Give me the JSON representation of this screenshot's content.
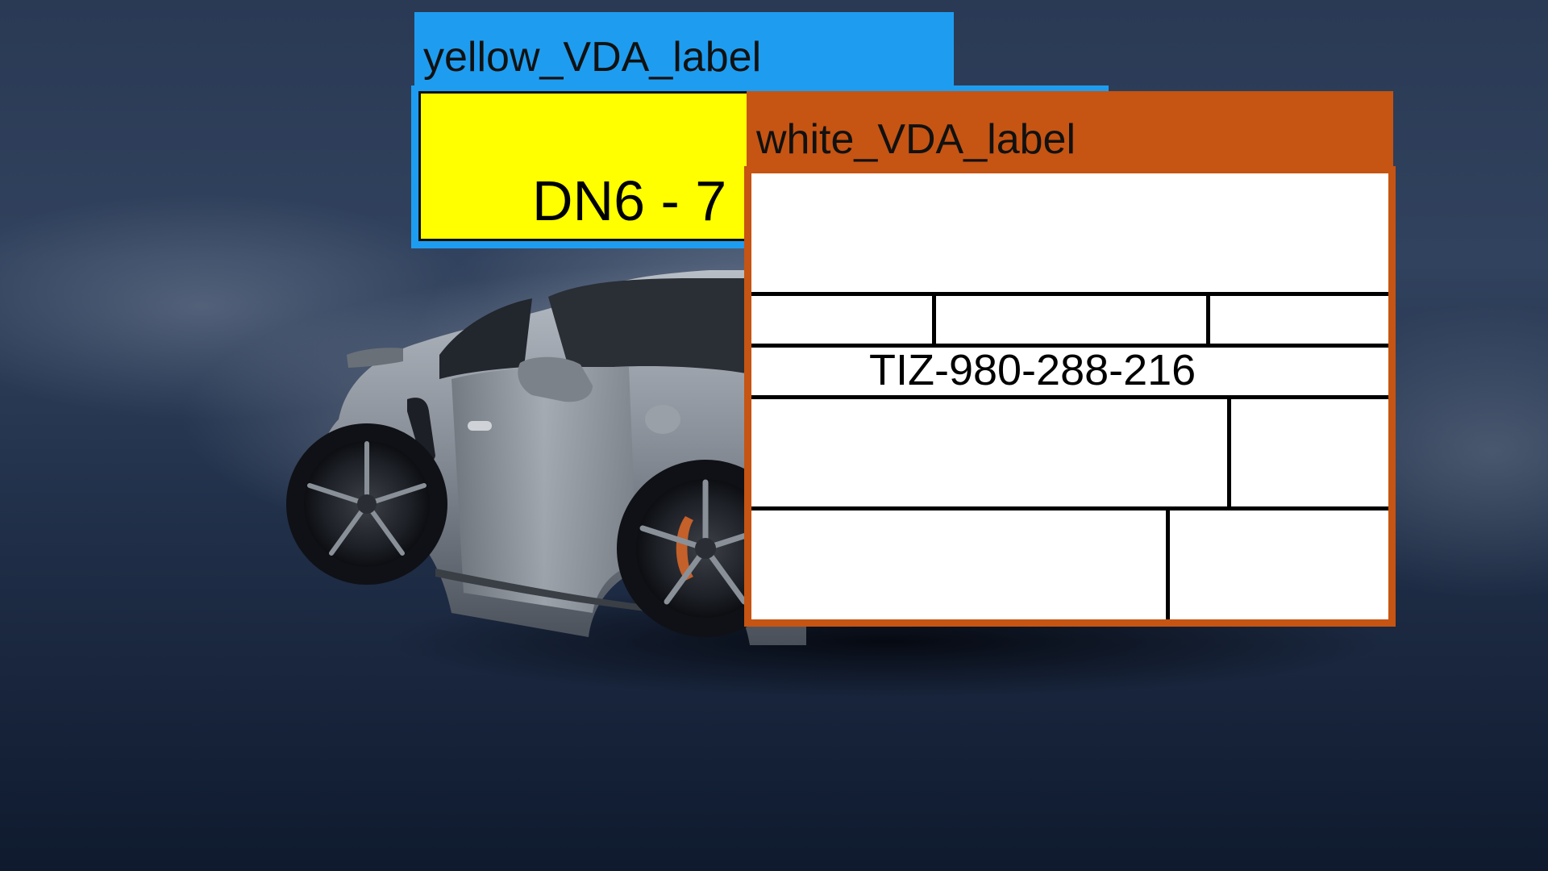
{
  "background": {
    "subject": "car-photo",
    "colors": {
      "backdrop_dark": "#0f1a2e",
      "backdrop_light": "#c9cfd8",
      "car_body": "#8e949c"
    }
  },
  "annotations": [
    {
      "label": "yellow_VDA_label",
      "tag_color": "#1e9df0",
      "fill_color": "#ffff00",
      "visible_text": "DN6 - 7"
    },
    {
      "label": "white_VDA_label",
      "tag_color": "#c65413",
      "fill_color": "#ffffff",
      "visible_text": "TIZ-980-288-216"
    }
  ]
}
